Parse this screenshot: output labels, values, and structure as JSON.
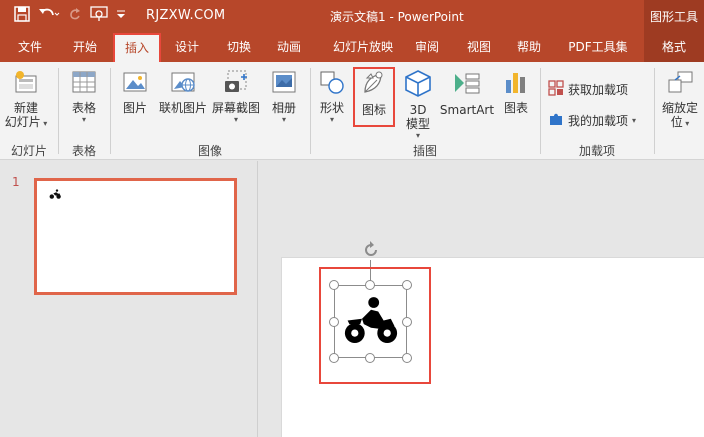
{
  "titlebar": {
    "site": "RJZXW.COM",
    "title": "演示文稿1 - PowerPoint",
    "tools_label": "图形工具"
  },
  "tabs": [
    {
      "label": "文件"
    },
    {
      "label": "开始"
    },
    {
      "label": "插入"
    },
    {
      "label": "设计"
    },
    {
      "label": "切换"
    },
    {
      "label": "动画"
    },
    {
      "label": "幻灯片放映"
    },
    {
      "label": "审阅"
    },
    {
      "label": "视图"
    },
    {
      "label": "帮助"
    },
    {
      "label": "PDF工具集"
    },
    {
      "label": "格式"
    }
  ],
  "ribbon": {
    "new_slide": "新建",
    "new_slide2": "幻灯片",
    "table": "表格",
    "picture": "图片",
    "online_picture": "联机图片",
    "screenshot": "屏幕截图",
    "album": "相册",
    "shapes": "形状",
    "icons": "图标",
    "model3d": "3D",
    "model3d2": "模型",
    "smartart": "SmartArt",
    "chart": "图表",
    "get_addins": "获取加载项",
    "my_addins": "我的加载项",
    "zoom": "缩放定",
    "zoom2": "位",
    "groups": {
      "slides": "幻灯片",
      "tables": "表格",
      "images": "图像",
      "illustrations": "插图",
      "addins": "加载项"
    }
  },
  "thumbnails": {
    "slide_number": "1"
  },
  "colors": {
    "accent": "#b7472a",
    "highlight": "#e8473b"
  }
}
